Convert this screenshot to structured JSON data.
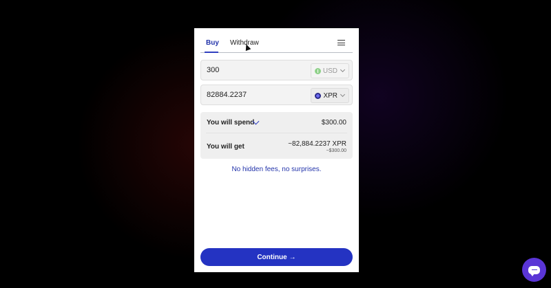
{
  "tabs": {
    "buy": "Buy",
    "withdraw": "Withdraw"
  },
  "icons": {
    "menu": "hamburger-menu-icon",
    "usd_coin": "usd-coin-icon",
    "xpr_coin": "xpr-coin-icon",
    "chevron": "chevron-down-icon",
    "arrow": "arrow-right-icon",
    "chat": "chat-icon"
  },
  "amount_field": {
    "value": "300",
    "currency": "USD"
  },
  "crypto_field": {
    "value": "82884.2237",
    "currency": "XPR"
  },
  "summary": {
    "spend_label": "You will spend",
    "spend_value": "$300.00",
    "get_label": "You will get",
    "get_value": "~82,884.2237 XPR",
    "get_sub": "~$300.00"
  },
  "tagline": "No hidden fees, no surprises.",
  "continue_label": "Continue",
  "continue_arrow": "→",
  "colors": {
    "accent": "#2433c2",
    "chat_fab": "#5a35d6"
  }
}
